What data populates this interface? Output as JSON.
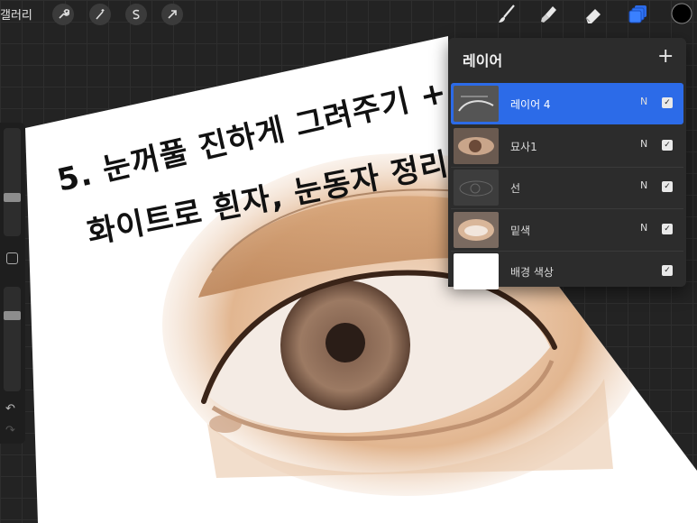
{
  "toolbar": {
    "gallery_label": "갤러리",
    "left_icons": [
      "wrench-icon",
      "magic-wand-icon",
      "selection-icon",
      "transform-arrow-icon"
    ],
    "right_icons": [
      "brush-icon",
      "smudge-icon",
      "eraser-icon",
      "layers-icon",
      "color-swatch-icon"
    ],
    "active_color": "#000000",
    "accent_color": "#2c6be8"
  },
  "sidebar": {
    "brush_size_level": 0.35,
    "opacity_level": 0.75,
    "icons": [
      "modify-square-icon",
      "undo-icon",
      "redo-icon"
    ]
  },
  "canvas": {
    "note_line1": "5. 눈꺼풀 진하게 그려주기 +",
    "note_line2": "화이트로 흰자, 눈동자 정리"
  },
  "layers_panel": {
    "title": "레이어",
    "add_label": "+",
    "layers": [
      {
        "name": "레이어 4",
        "mode": "N",
        "visible": true,
        "active": true
      },
      {
        "name": "묘사1",
        "mode": "N",
        "visible": true,
        "active": false
      },
      {
        "name": "선",
        "mode": "N",
        "visible": true,
        "active": false
      },
      {
        "name": "밑색",
        "mode": "N",
        "visible": true,
        "active": false
      },
      {
        "name": "배경 색상",
        "mode": "",
        "visible": true,
        "active": false
      }
    ]
  }
}
